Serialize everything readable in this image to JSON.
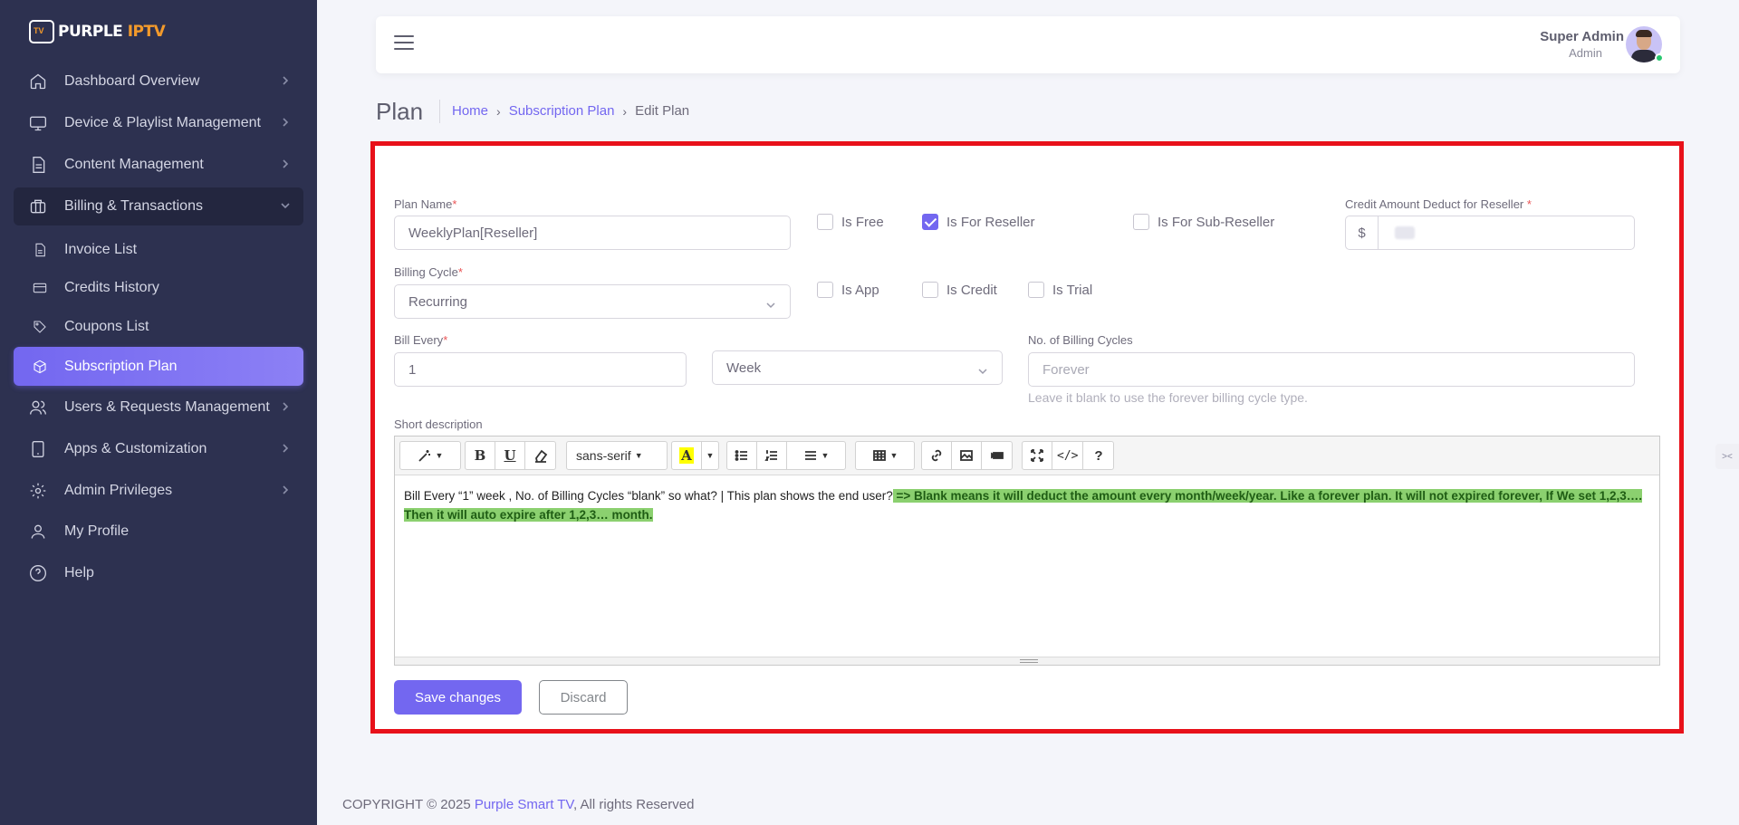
{
  "brand": {
    "name_part1": "PURPLE",
    "name_part2": "IPTV",
    "logo_icon": "tv-logo-icon",
    "accent": "#f39a2b"
  },
  "sidebar": {
    "items": [
      {
        "label": "Dashboard Overview",
        "icon": "home-icon"
      },
      {
        "label": "Device & Playlist Management",
        "icon": "monitor-icon"
      },
      {
        "label": "Content Management",
        "icon": "file-icon"
      },
      {
        "label": "Billing & Transactions",
        "icon": "briefcase-icon",
        "expanded": true
      },
      {
        "label": "Users & Requests Management",
        "icon": "users-icon"
      },
      {
        "label": "Apps & Customization",
        "icon": "tablet-icon"
      },
      {
        "label": "Admin Privileges",
        "icon": "settings-icon"
      },
      {
        "label": "My Profile",
        "icon": "user-icon"
      },
      {
        "label": "Help",
        "icon": "help-icon"
      }
    ],
    "subitems": [
      {
        "label": "Invoice List",
        "icon": "file-text-icon"
      },
      {
        "label": "Credits History",
        "icon": "credit-card-icon"
      },
      {
        "label": "Coupons List",
        "icon": "tag-icon"
      },
      {
        "label": "Subscription Plan",
        "icon": "package-icon",
        "active": true
      }
    ],
    "bg": "#2d3150"
  },
  "header": {
    "user_name": "Super Admin",
    "user_role": "Admin"
  },
  "page": {
    "title": "Plan",
    "breadcrumb": [
      "Home",
      "Subscription Plan",
      "Edit Plan"
    ]
  },
  "form": {
    "plan_name_label": "Plan Name",
    "plan_name_value": "WeeklyPlan[Reseller]",
    "is_free": "Is Free",
    "is_for_reseller": "Is For Reseller",
    "is_for_sub_reseller": "Is For Sub-Reseller",
    "credit_label": "Credit Amount Deduct for Reseller",
    "credit_prefix": "$",
    "billing_cycle_label": "Billing Cycle",
    "billing_cycle_value": "Recurring",
    "is_app": "Is App",
    "is_credit": "Is Credit",
    "is_trial": "Is Trial",
    "bill_every_label": "Bill Every",
    "bill_every_value": "1",
    "bill_unit_value": "Week",
    "billing_cycles_label": "No. of Billing Cycles",
    "billing_cycles_placeholder": "Forever",
    "billing_cycles_hint": "Leave it blank to use the forever billing cycle type.",
    "short_desc_label": "Short description",
    "required_mark": "*",
    "checked": {
      "is_for_reseller": true
    }
  },
  "editor": {
    "font_name": "sans-serif",
    "text_plain": "Bill Every “1” week , No. of Billing Cycles “blank” so what? | This plan shows the end user?",
    "text_highlight": " => Blank means it will deduct the amount every month/week/year. Like a forever plan. It will not expired forever, If We set 1,2,3…. Then it will auto expire after 1,2,3… month. ",
    "highlight_color": "#8bd06f"
  },
  "actions": {
    "save": "Save changes",
    "discard": "Discard"
  },
  "footer": {
    "prefix": "COPYRIGHT © 2025 ",
    "link": "Purple Smart TV",
    "suffix": ", All rights Reserved"
  },
  "colors": {
    "primary": "#7367f0",
    "highlight_border": "#e8111a"
  }
}
